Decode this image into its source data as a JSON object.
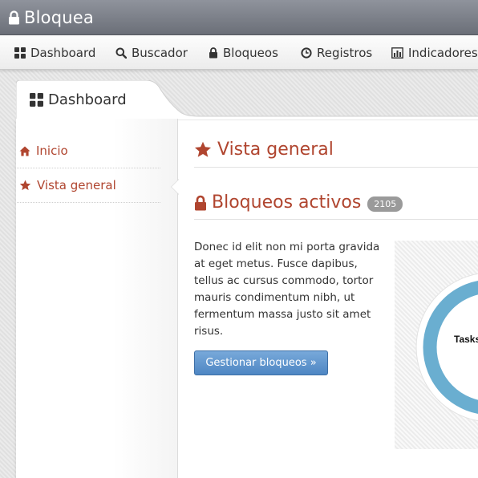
{
  "app": {
    "title": "Bloquea"
  },
  "nav": {
    "items": [
      {
        "label": "Dashboard",
        "icon": "dashboard-icon"
      },
      {
        "label": "Buscador",
        "icon": "search-icon"
      },
      {
        "label": "Bloqueos",
        "icon": "lock-icon"
      },
      {
        "label": "Registros",
        "icon": "clock-icon"
      },
      {
        "label": "Indicadores",
        "icon": "bar-chart-icon"
      }
    ]
  },
  "tab": {
    "label": "Dashboard",
    "icon": "dashboard-icon"
  },
  "sidebar": {
    "items": [
      {
        "label": "Inicio",
        "icon": "home-icon"
      },
      {
        "label": "Vista general",
        "icon": "star-icon",
        "active": true
      }
    ]
  },
  "main": {
    "heading": "Vista general",
    "section_title": "Bloqueos activos",
    "count_badge": "2105",
    "description": "Donec id elit non mi porta gravida at eget metus. Fusce dapibus, tellus ac cursus commodo, tortor mauris condimentum nibh, ut fermentum massa justo sit amet risus.",
    "button_label": "Gestionar bloqueos »",
    "chart_label": "Tasks"
  },
  "colors": {
    "accent": "#b0452f",
    "titlebar": "#7a7e87",
    "button": "#5a90c9",
    "donut": "#6aaed0"
  }
}
